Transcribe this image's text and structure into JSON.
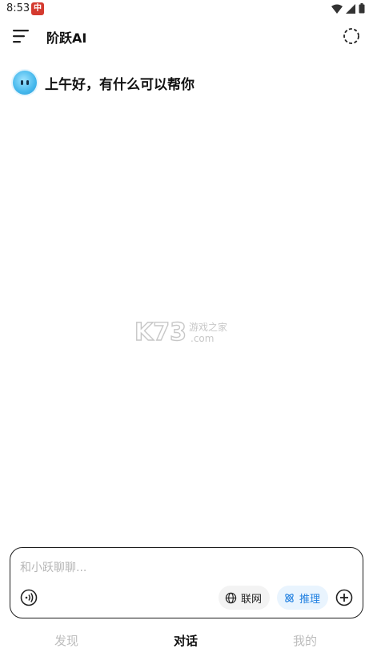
{
  "status_bar": {
    "time": "8:53",
    "app_icon_glyph": "中"
  },
  "header": {
    "title": "阶跃AI",
    "menu_icon": "menu-icon",
    "new_chat_icon": "dashed-circle-icon"
  },
  "greeting": {
    "text": "上午好，有什么可以帮你"
  },
  "watermark": {
    "text_main": "K73",
    "text_cn": "游戏之家",
    "text_domain": ".com"
  },
  "composer": {
    "placeholder": "和小跃聊聊...",
    "web_chip_label": "联网",
    "reason_chip_label": "推理"
  },
  "bottom_nav": {
    "discover": "发现",
    "chat": "对话",
    "mine": "我的"
  },
  "colors": {
    "accent": "#1f7fe0",
    "reason_chip_bg": "#e9f4fe",
    "inactive_nav": "#bdbdbd"
  }
}
